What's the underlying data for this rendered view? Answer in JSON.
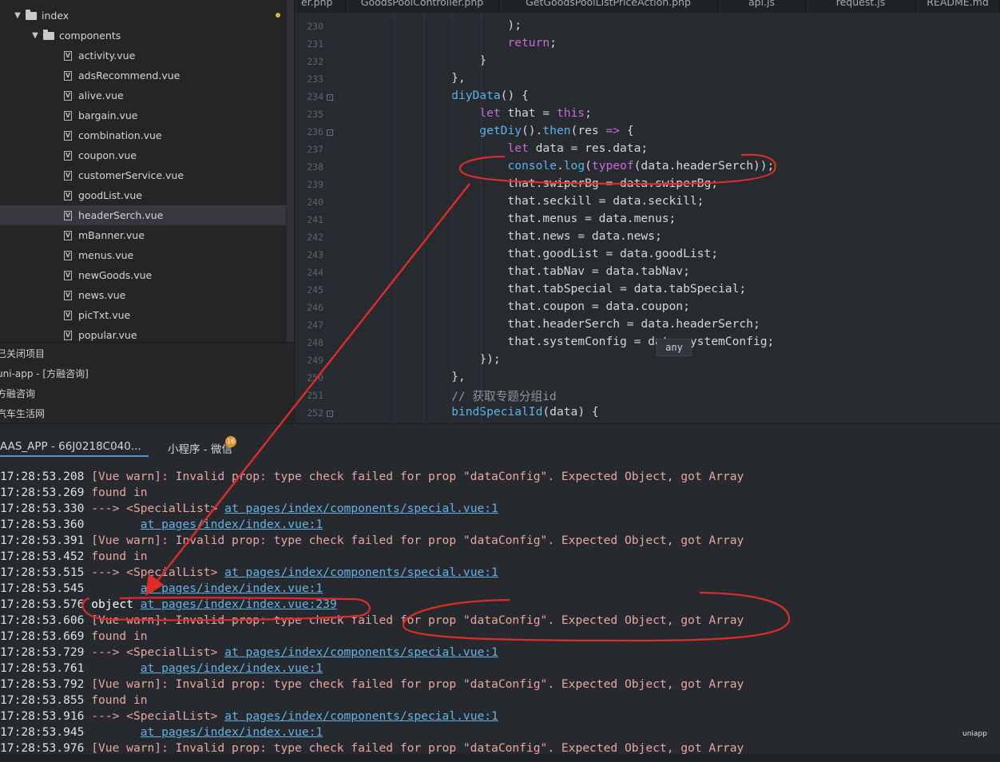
{
  "sidebar": {
    "root": {
      "label": "index"
    },
    "folder": {
      "label": "components"
    },
    "files": [
      {
        "label": "activity.vue"
      },
      {
        "label": "adsRecommend.vue"
      },
      {
        "label": "alive.vue"
      },
      {
        "label": "bargain.vue"
      },
      {
        "label": "combination.vue"
      },
      {
        "label": "coupon.vue"
      },
      {
        "label": "customerService.vue"
      },
      {
        "label": "goodList.vue"
      },
      {
        "label": "headerSerch.vue",
        "selected": true
      },
      {
        "label": "mBanner.vue"
      },
      {
        "label": "menus.vue"
      },
      {
        "label": "newGoods.vue"
      },
      {
        "label": "news.vue"
      },
      {
        "label": "picTxt.vue"
      },
      {
        "label": "popular.vue"
      }
    ],
    "closed_projects": [
      {
        "label": "已关闭项目"
      },
      {
        "label": "uni-app - [方融咨询]"
      },
      {
        "label": "方融咨询"
      },
      {
        "label": "汽车生活网"
      }
    ]
  },
  "tabs": [
    {
      "label": "er.php"
    },
    {
      "label": "GoodsPoolController.php"
    },
    {
      "label": "GetGoodsPoolListPriceAction.php"
    },
    {
      "label": "api.js"
    },
    {
      "label": "request.js"
    },
    {
      "label": "README.md"
    }
  ],
  "editor": {
    "lines": [
      {
        "num": "230",
        "text": "            );"
      },
      {
        "num": "231",
        "text": "            return;"
      },
      {
        "num": "232",
        "text": "        }"
      },
      {
        "num": "233",
        "text": "    },"
      },
      {
        "num": "234",
        "text": "    diyData() {"
      },
      {
        "num": "235",
        "text": "        let that = this;"
      },
      {
        "num": "236",
        "text": "        getDiy().then(res => {"
      },
      {
        "num": "237",
        "text": "            let data = res.data;"
      },
      {
        "num": "238",
        "text": "            console.log(typeof(data.headerSerch));"
      },
      {
        "num": "239",
        "text": "            that.swiperBg = data.swiperBg;"
      },
      {
        "num": "240",
        "text": "            that.seckill = data.seckill;"
      },
      {
        "num": "241",
        "text": "            that.menus = data.menus;"
      },
      {
        "num": "242",
        "text": "            that.news = data.news;"
      },
      {
        "num": "243",
        "text": "            that.goodList = data.goodList;"
      },
      {
        "num": "244",
        "text": "            that.tabNav = data.tabNav;"
      },
      {
        "num": "245",
        "text": "            that.tabSpecial = data.tabSpecial;"
      },
      {
        "num": "246",
        "text": "            that.coupon = data.coupon;"
      },
      {
        "num": "247",
        "text": "            that.headerSerch = data.headerSerch;"
      },
      {
        "num": "248",
        "text": "            that.systemConfig = data.systemConfig;"
      },
      {
        "num": "249",
        "text": "        });"
      },
      {
        "num": "250",
        "text": "    },"
      },
      {
        "num": "251",
        "text": "    // 获取专题分组id"
      },
      {
        "num": "252",
        "text": "    bindSpecialId(data) {"
      }
    ],
    "tooltip": "any"
  },
  "console_tabs": [
    {
      "label": "AAS_APP - 66J0218C040..."
    },
    {
      "label": "小程序 - 微信"
    }
  ],
  "console_badge": "16",
  "console": [
    {
      "time": "17:28:53.208",
      "kind": "warn",
      "msg": " [Vue warn]: Invalid prop: type check failed for prop \"dataConfig\". Expected Object, got Array"
    },
    {
      "time": "17:28:53.269",
      "kind": "warn",
      "msg": " found in"
    },
    {
      "time": "17:28:53.330",
      "kind": "warn",
      "msg": " ---> <SpecialList> ",
      "link": "at pages/index/components/special.vue:1"
    },
    {
      "time": "17:28:53.360",
      "kind": "warn",
      "msg": "        ",
      "link": "at pages/index/index.vue:1"
    },
    {
      "time": "17:28:53.391",
      "kind": "warn",
      "msg": " [Vue warn]: Invalid prop: type check failed for prop \"dataConfig\". Expected Object, got Array"
    },
    {
      "time": "17:28:53.452",
      "kind": "warn",
      "msg": " found in"
    },
    {
      "time": "17:28:53.515",
      "kind": "warn",
      "msg": " ---> <SpecialList> ",
      "link": "at pages/index/components/special.vue:1"
    },
    {
      "time": "17:28:53.545",
      "kind": "warn",
      "msg": "        ",
      "link": "at pages/index/index.vue:1"
    },
    {
      "time": "17:28:53.576",
      "kind": "log",
      "msg": " object ",
      "link": "at pages/index/index.vue:239"
    },
    {
      "time": "17:28:53.606",
      "kind": "warn",
      "msg": " [Vue warn]: Invalid prop: type check failed for prop \"dataConfig\". Expected Object, got Array"
    },
    {
      "time": "17:28:53.669",
      "kind": "warn",
      "msg": " found in"
    },
    {
      "time": "17:28:53.729",
      "kind": "warn",
      "msg": " ---> <SpecialList> ",
      "link": "at pages/index/components/special.vue:1"
    },
    {
      "time": "17:28:53.761",
      "kind": "warn",
      "msg": "        ",
      "link": "at pages/index/index.vue:1"
    },
    {
      "time": "17:28:53.792",
      "kind": "warn",
      "msg": " [Vue warn]: Invalid prop: type check failed for prop \"dataConfig\". Expected Object, got Array"
    },
    {
      "time": "17:28:53.855",
      "kind": "warn",
      "msg": " found in"
    },
    {
      "time": "17:28:53.916",
      "kind": "warn",
      "msg": " ---> <SpecialList> ",
      "link": "at pages/index/components/special.vue:1"
    },
    {
      "time": "17:28:53.945",
      "kind": "warn",
      "msg": "        ",
      "link": "at pages/index/index.vue:1"
    },
    {
      "time": "17:28:53.976",
      "kind": "warn",
      "msg": " [Vue warn]: Invalid prop: type check failed for prop \"dataConfig\". Expected Object, got Array"
    }
  ],
  "colors": {
    "annotation": "#e02b2b",
    "link": "#63b3e8",
    "keyword": "#c76bd8",
    "function": "#5bb4ea"
  }
}
